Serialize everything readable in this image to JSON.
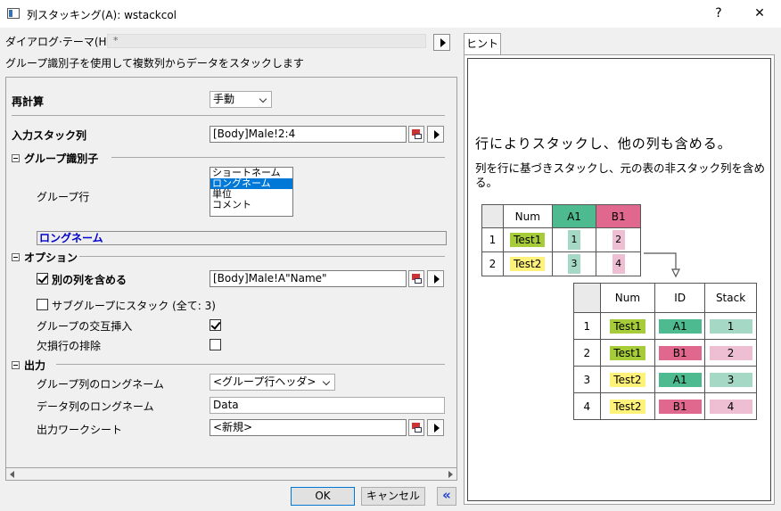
{
  "window": {
    "title": "列スタッキング(A): wstackcol",
    "help": "?",
    "close": "✕"
  },
  "theme": {
    "label": "ダイアログ·テーマ(H)",
    "value": "*"
  },
  "description": "グループ識別子を使用して複数列からデータをスタックします",
  "form": {
    "recalc": {
      "label": "再計算",
      "value": "手動"
    },
    "input": {
      "label": "入力スタック列",
      "value": "[Body]Male!2:4"
    },
    "group_section": "グループ識別子",
    "group_rows": {
      "label": "グループ行",
      "options": [
        "ショートネーム",
        "ロングネーム",
        "単位",
        "コメント"
      ],
      "selected_index": 1
    },
    "selected_display": "ロングネーム",
    "options_section": "オプション",
    "include_other": {
      "label": "別の列を含める",
      "checked": true,
      "value": "[Body]Male!A\"Name\""
    },
    "subgroup": {
      "label": "サブグループにスタック (全て: 3)",
      "checked": false
    },
    "interleave": {
      "label": "グループの交互挿入",
      "checked": true
    },
    "exclude_missing": {
      "label": "欠損行の排除",
      "checked": false
    },
    "output_section": "出力",
    "group_longname": {
      "label": "グループ列のロングネーム",
      "value": "<グループ行ヘッダ>"
    },
    "data_longname": {
      "label": "データ列のロングネーム",
      "value": "Data"
    },
    "output_sheet": {
      "label": "出力ワークシート",
      "value": "<新規>"
    }
  },
  "buttons": {
    "ok": "OK",
    "cancel": "キャンセル",
    "collapse": "«"
  },
  "hint": {
    "tab": "ヒント",
    "title": "行によりスタックし、他の列も含める。",
    "body": "列を行に基づきスタックし、元の表の非スタック列を含める。",
    "colors": {
      "green": "#4dbb8f",
      "pink": "#e0688f",
      "lime": "#a6cc3a",
      "yellow": "#fff27a",
      "lightgreen": "#a6d9c5",
      "lightpink": "#eebfd3"
    },
    "src_table": {
      "headers": [
        "Num",
        "A1",
        "B1"
      ],
      "rows": [
        [
          "1",
          "Test1",
          "1",
          "2"
        ],
        [
          "2",
          "Test2",
          "3",
          "4"
        ]
      ]
    },
    "dst_table": {
      "headers": [
        "Num",
        "ID",
        "Stack"
      ],
      "rows": [
        [
          "1",
          "Test1",
          "A1",
          "1"
        ],
        [
          "2",
          "Test1",
          "B1",
          "2"
        ],
        [
          "3",
          "Test2",
          "A1",
          "3"
        ],
        [
          "4",
          "Test2",
          "B1",
          "4"
        ]
      ]
    }
  }
}
